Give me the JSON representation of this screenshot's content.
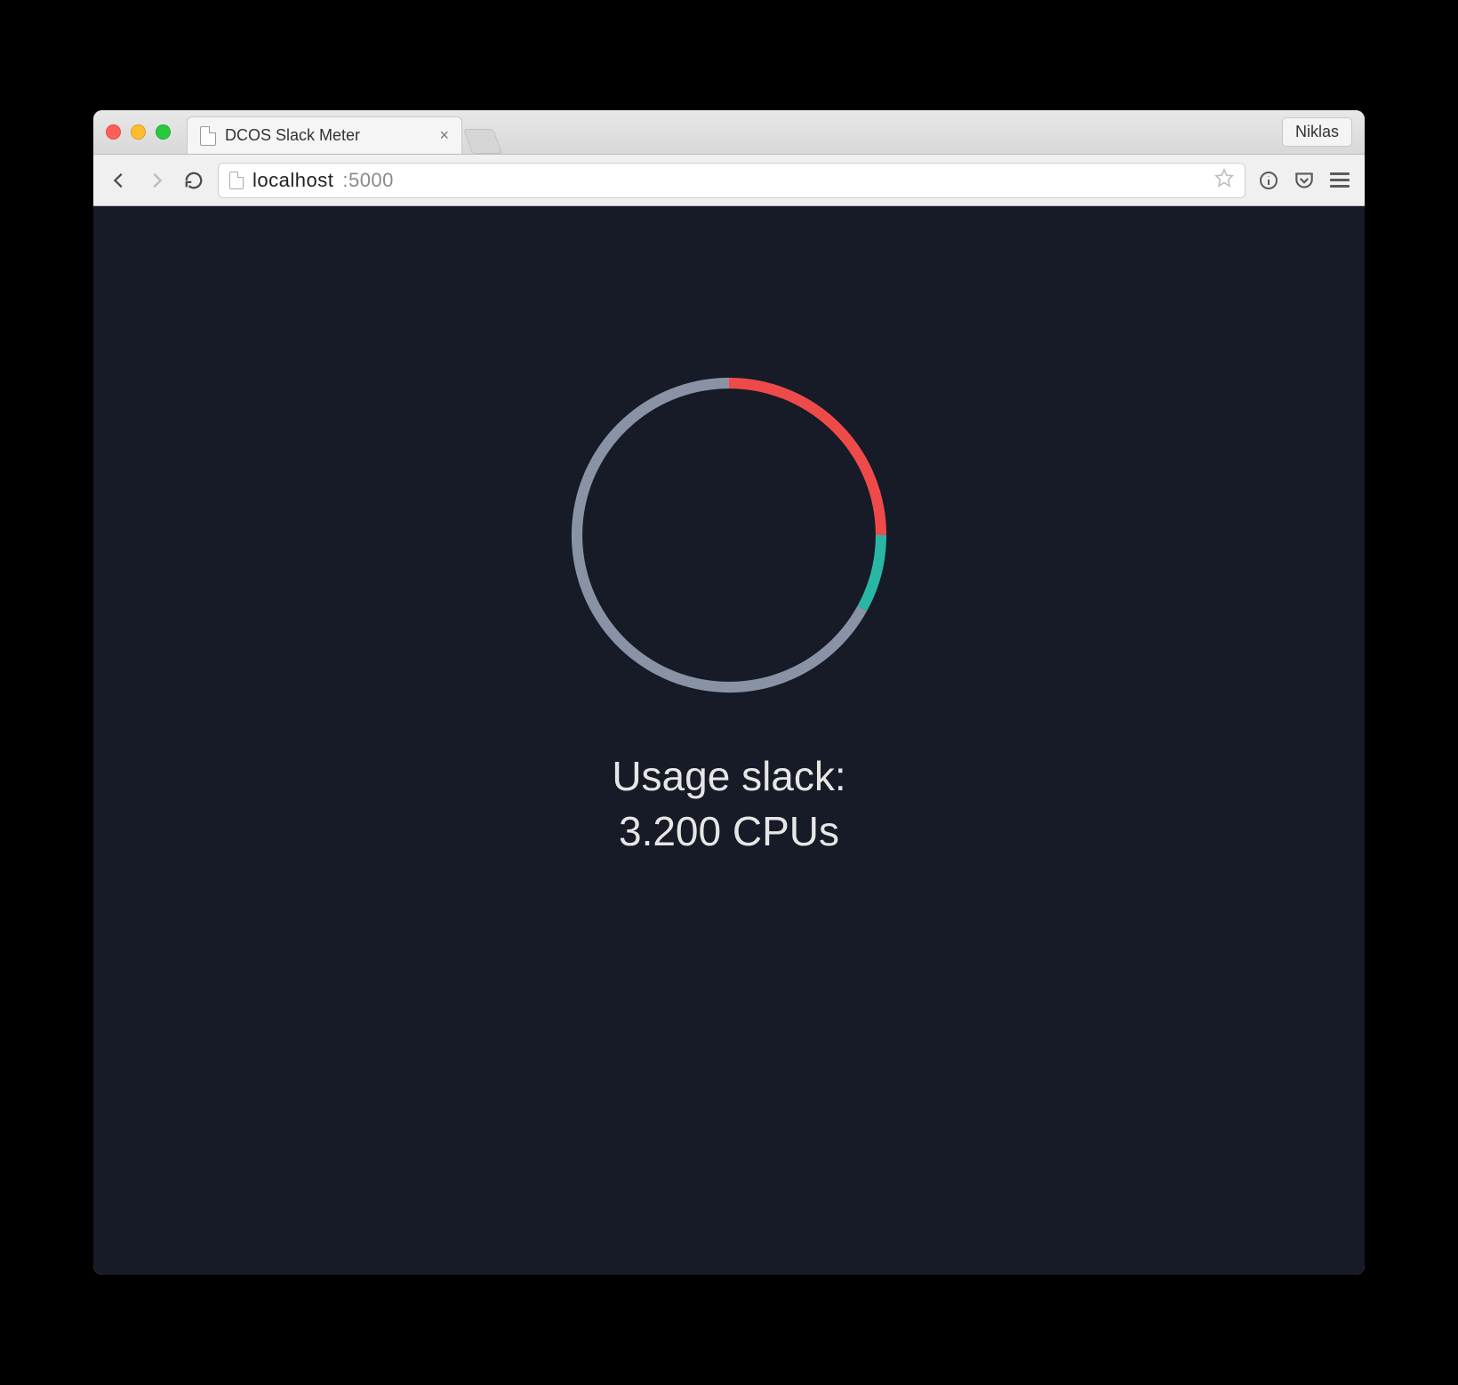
{
  "browser": {
    "tab_title": "DCOS Slack Meter",
    "profile_button": "Niklas",
    "url_host": "localhost",
    "url_port": ":5000"
  },
  "metric": {
    "label": "Usage slack:",
    "value": "3.200 CPUs"
  },
  "chart_data": {
    "type": "pie",
    "title": "",
    "series": [
      {
        "name": "red",
        "value": 25,
        "color": "#ef4a4a"
      },
      {
        "name": "teal",
        "value": 8,
        "color": "#29b6a4"
      },
      {
        "name": "grey",
        "value": 67,
        "color": "#8a93a6"
      }
    ]
  }
}
